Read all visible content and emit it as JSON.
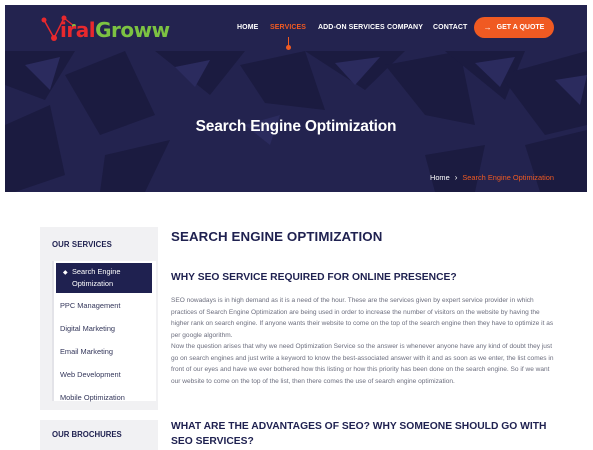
{
  "brand": {
    "logo_part1": "iral",
    "logo_part2": "Groww",
    "colors": {
      "primary": "#23234f",
      "accent": "#f05a22",
      "logo_red": "#e8282d",
      "logo_green": "#7cc242"
    }
  },
  "nav": {
    "items": [
      {
        "label": "HOME"
      },
      {
        "label": "SERVICES"
      },
      {
        "label": "ADD-ON SERVICES"
      },
      {
        "label": "COMPANY"
      },
      {
        "label": "CONTACT"
      }
    ],
    "active_item": "SERVICES",
    "cta_label": "GET A QUOTE",
    "cta_icon": "arrow-right-icon"
  },
  "hero": {
    "title": "Search Engine Optimization",
    "breadcrumb": {
      "home": "Home",
      "separator": "›",
      "current": "Search Engine Optimization"
    }
  },
  "sidebar": {
    "title": "OUR SERVICES",
    "items": [
      {
        "label": "Search Engine Optimization"
      },
      {
        "label": "PPC Management"
      },
      {
        "label": "Digital Marketing"
      },
      {
        "label": "Email Marketing"
      },
      {
        "label": "Web Development"
      },
      {
        "label": "Mobile Optimization"
      }
    ],
    "brochures_title": "OUR BROCHURES"
  },
  "main": {
    "title": "SEARCH ENGINE OPTIMIZATION",
    "section1_title": "WHY SEO SERVICE REQUIRED FOR ONLINE PRESENCE?",
    "paragraph1": "SEO nowadays is in high demand as it is a need of the hour. These are the services given by expert service provider in which practices of Search Engine Optimization are being used in order to increase the number of visitors on the website by having the higher rank on search engine. If anyone wants their website to come on the top of the search engine then they have to optimize it as per google algorithm.",
    "paragraph2": "Now the question arises that why we need Optimization Service so the answer is whenever anyone have any kind of doubt they just go on search engines and just write a keyword to know the best-associated answer with it and as soon as we enter, the list comes in front of our eyes and have we ever bothered how this listing or how this priority has been done on the search engine. So if we want our website to come on the top of the list, then there comes the use of search engine optimization.",
    "section2_title": "WHAT ARE THE ADVANTAGES OF SEO? WHY SOMEONE SHOULD GO WITH SEO SERVICES?"
  }
}
